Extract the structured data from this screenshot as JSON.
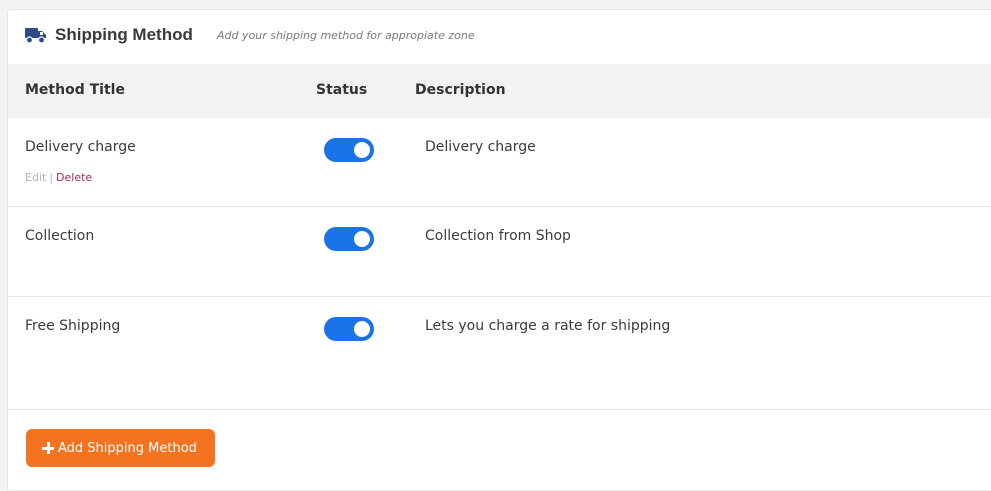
{
  "header": {
    "icon": "truck-icon",
    "title": "Shipping Method",
    "subtitle": "Add your shipping method for appropiate zone"
  },
  "columns": {
    "title": "Method Title",
    "status": "Status",
    "description": "Description"
  },
  "methods": [
    {
      "title": "Delivery charge",
      "enabled": true,
      "description": "Delivery charge",
      "actions": {
        "edit": "Edit",
        "separator": "|",
        "delete": "Delete"
      }
    },
    {
      "title": "Collection",
      "enabled": true,
      "description": "Collection from Shop"
    },
    {
      "title": "Free Shipping",
      "enabled": true,
      "description": "Lets you charge a rate for shipping"
    }
  ],
  "add_button": {
    "icon": "plus-icon",
    "label": "Add Shipping Method"
  },
  "colors": {
    "toggle_on": "#1a73e8",
    "primary_button": "#f47321",
    "delete_link": "#a52a5b"
  }
}
